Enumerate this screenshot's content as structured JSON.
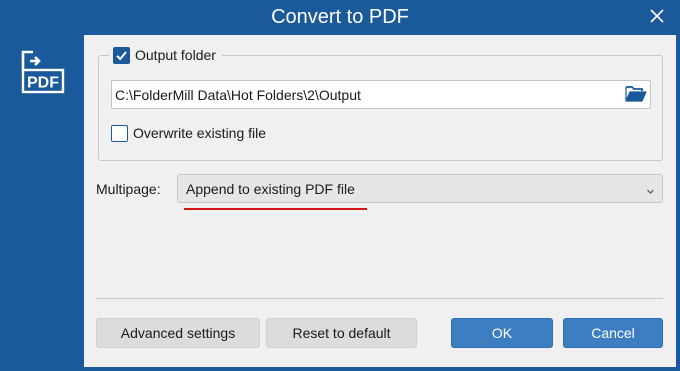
{
  "window": {
    "title": "Convert to PDF",
    "accent_color": "#1b5a9a",
    "close_icon": "close-icon",
    "sidebar_icon": "pdf-convert-icon"
  },
  "output": {
    "checkbox_label": "Output folder",
    "checked": true,
    "path": "C:\\FolderMill Data\\Hot Folders\\2\\Output",
    "browse_icon": "folder-open-icon"
  },
  "overwrite": {
    "label": "Overwrite existing file",
    "checked": false
  },
  "multipage": {
    "label": "Multipage:",
    "selected": "Append to existing PDF file",
    "highlight_color": "#d31414"
  },
  "buttons": {
    "advanced": "Advanced settings",
    "reset": "Reset to default",
    "ok": "OK",
    "cancel": "Cancel"
  }
}
